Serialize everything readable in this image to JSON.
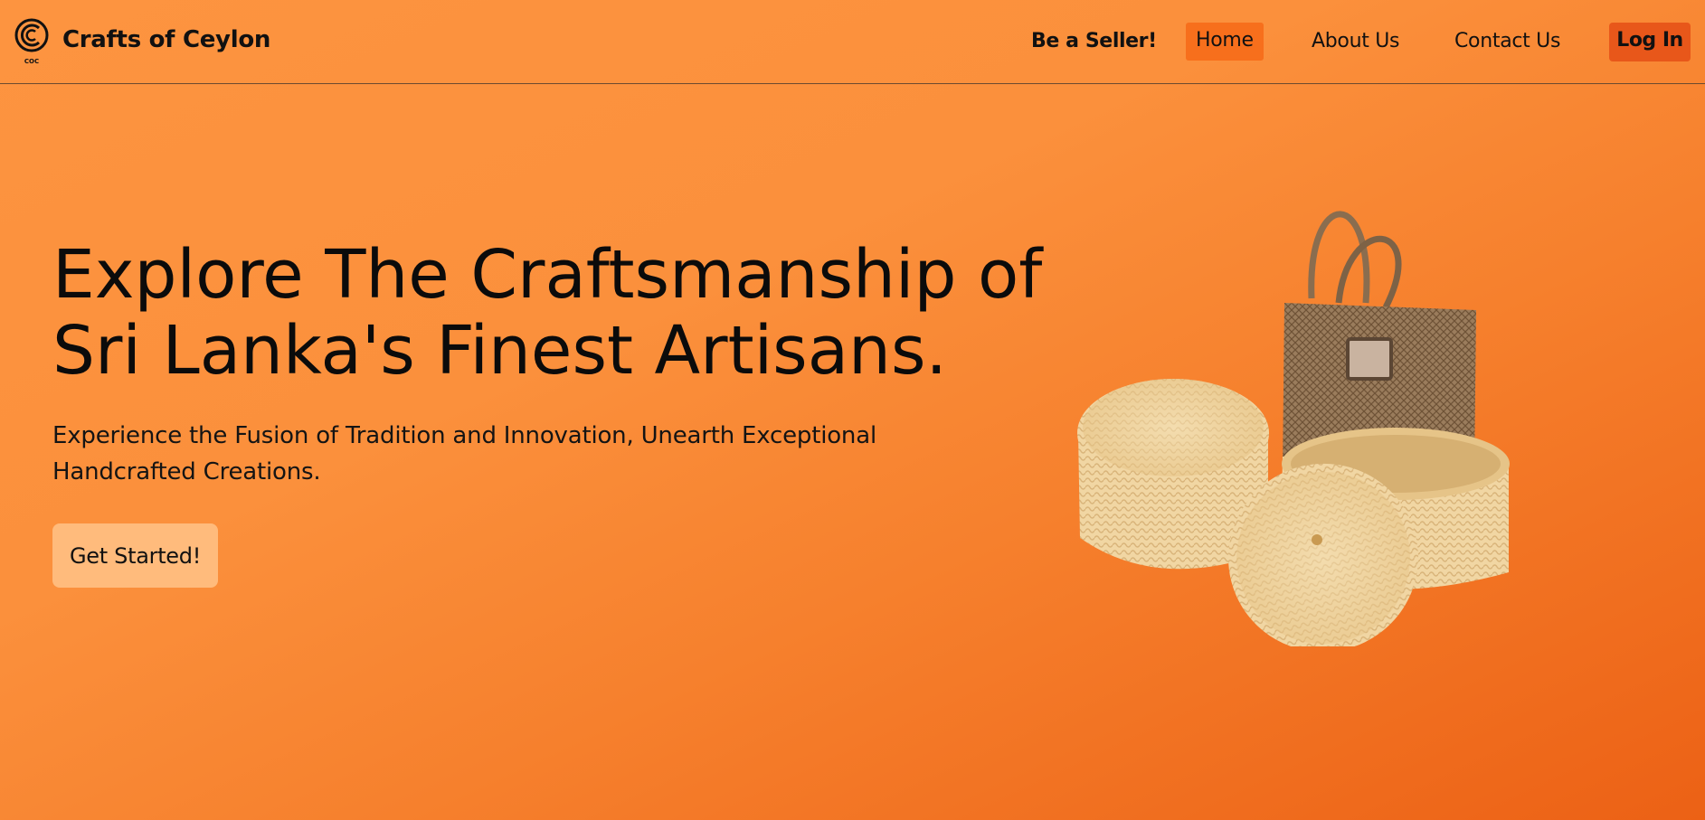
{
  "header": {
    "brand_name": "Crafts of Ceylon",
    "logo_text": "COC",
    "nav": {
      "seller": "Be a Seller!",
      "home": "Home",
      "about": "About Us",
      "contact": "Contact Us",
      "login": "Log In"
    }
  },
  "hero": {
    "title_line1": "Explore The Craftsmanship of",
    "title_line2": "Sri Lanka's Finest Artisans.",
    "subtitle_line1": "Experience the Fusion of Tradition and Innovation, Unearth Exceptional",
    "subtitle_line2": "Handcrafted Creations.",
    "cta_label": "Get Started!"
  },
  "colors": {
    "background_light": "#fd9440",
    "background_dark": "#ec6115",
    "nav_active": "#f76f1c",
    "login_button": "#e8571a",
    "cta_button": "#ffbb7c"
  },
  "icons": {
    "logo": "coc-logo-icon",
    "hero_image": "woven-baskets-image"
  }
}
